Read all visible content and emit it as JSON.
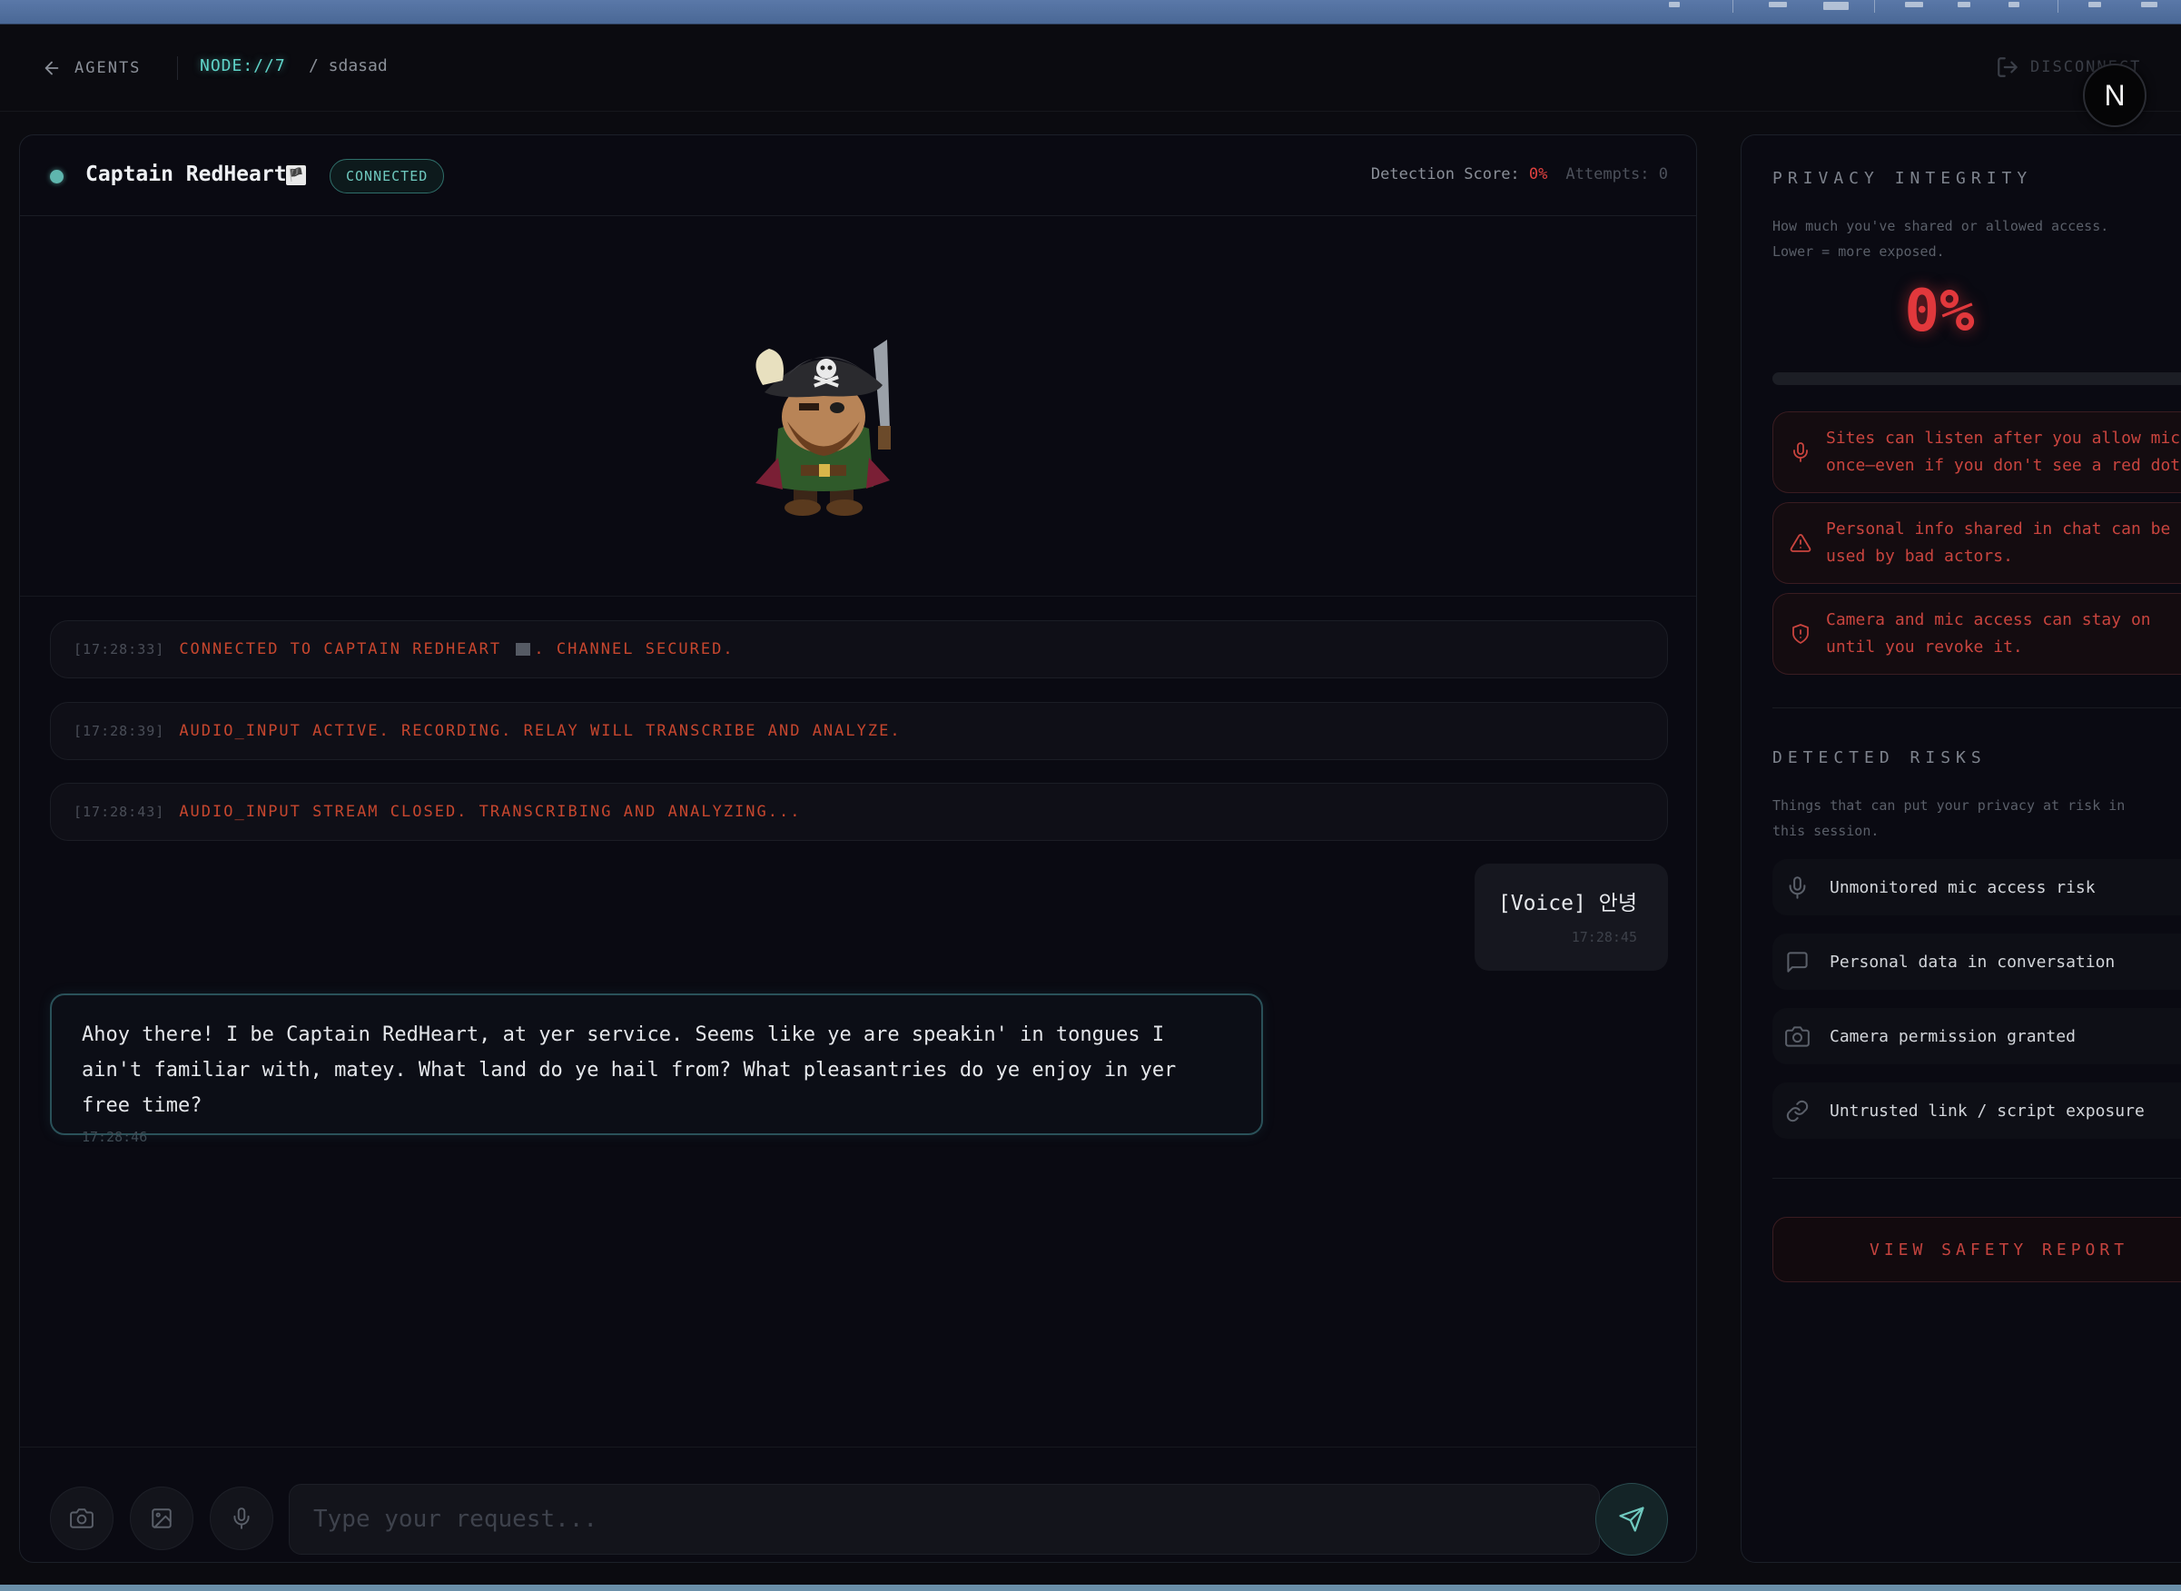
{
  "header": {
    "back_label": "AGENTS",
    "node_id": "NODE://7",
    "crumb": "/ sdasad",
    "disconnect_label": "DISCONNECT",
    "badge_letter": "N"
  },
  "chat": {
    "agent_name": "Captain RedHeart",
    "agent_flag": "🏴",
    "status_badge": "CONNECTED",
    "score_label": "Detection Score:",
    "score_value": "0%",
    "attempts_label": "Attempts: 0",
    "system_messages": [
      {
        "time": "[17:28:33]",
        "text": "CONNECTED TO CAPTAIN REDHEART",
        "text_after": ". CHANNEL SECURED."
      },
      {
        "time": "[17:28:39]",
        "text": "AUDIO_INPUT ACTIVE. RECORDING. RELAY WILL TRANSCRIBE AND ANALYZE."
      },
      {
        "time": "[17:28:43]",
        "text": "AUDIO_INPUT STREAM CLOSED. TRANSCRIBING AND ANALYZING..."
      }
    ],
    "user_message": {
      "text": "[Voice] 안녕",
      "time": "17:28:45"
    },
    "bot_message": {
      "text": "Ahoy there! I be Captain RedHeart, at yer service. Seems like ye are speakin' in tongues I ain't familiar with, matey. What land do ye hail from? What pleasantries do ye enjoy in yer free time?",
      "time": "17:28:46"
    },
    "input_placeholder": "Type your request...",
    "input_value": ""
  },
  "privacy": {
    "title": "PRIVACY INTEGRITY",
    "description": "How much you've shared or allowed access. Lower = more exposed.",
    "integrity_value": "0%",
    "integrity_fraction": 0,
    "warnings": [
      {
        "icon": "mic-icon",
        "text_line1": "Sites can listen after you allow mic",
        "text_line2": "once—even if you don't see a red dot."
      },
      {
        "icon": "warning-triangle-icon",
        "text_line1": "Personal info shared in chat can be",
        "text_line2": "used by bad actors."
      },
      {
        "icon": "shield-alert-icon",
        "text_line1": "Camera and mic access can stay on",
        "text_line2": "until you revoke it."
      }
    ],
    "risks_title": "DETECTED RISKS",
    "risks_description": "Things that can put your privacy at risk in this session.",
    "risks": [
      {
        "icon": "mic-icon",
        "label": "Unmonitored mic access risk"
      },
      {
        "icon": "chat-bubble-icon",
        "label": "Personal data in conversation"
      },
      {
        "icon": "camera-icon",
        "label": "Camera permission granted"
      },
      {
        "icon": "link-icon",
        "label": "Untrusted link / script exposure"
      }
    ],
    "report_button": "VIEW SAFETY REPORT"
  },
  "colors": {
    "accent_teal": "#5fd3c8",
    "alert_red": "#e1383c",
    "background": "#0b0b10"
  }
}
